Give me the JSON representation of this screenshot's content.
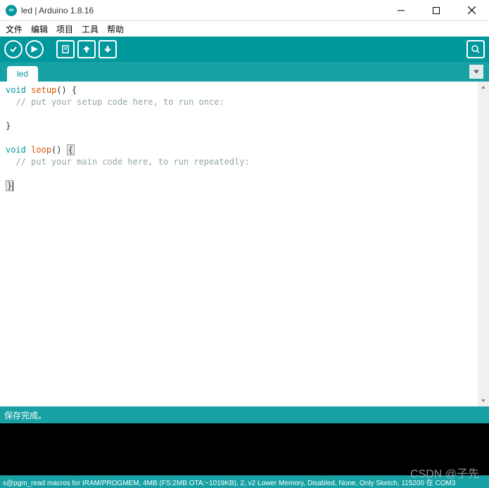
{
  "titlebar": {
    "title": "led | Arduino 1.8.16"
  },
  "menubar": {
    "file": "文件",
    "edit": "编辑",
    "sketch": "项目",
    "tools": "工具",
    "help": "帮助"
  },
  "tabs": {
    "active": "led"
  },
  "code": {
    "void1": "void",
    "setup_fn": "setup",
    "setup_parens": "() ",
    "open_brace1": "{",
    "setup_comment": "  // put your setup code here, to run once:",
    "close_brace1": "}",
    "void2": "void",
    "loop_fn": "loop",
    "loop_parens": "() ",
    "open_brace2": "{",
    "loop_comment": "  // put your main code here, to run repeatedly:",
    "close_brace2": "}"
  },
  "status": {
    "message": "保存完成。"
  },
  "bottombar": {
    "text": "s@pgm_read macros for IRAM/PROGMEM, 4MB (FS:2MB OTA:~1019KB), 2, v2 Lower Memory, Disabled, None, Only Sketch, 115200 在 COM3"
  },
  "watermark": {
    "text": "CSDN @子先"
  }
}
